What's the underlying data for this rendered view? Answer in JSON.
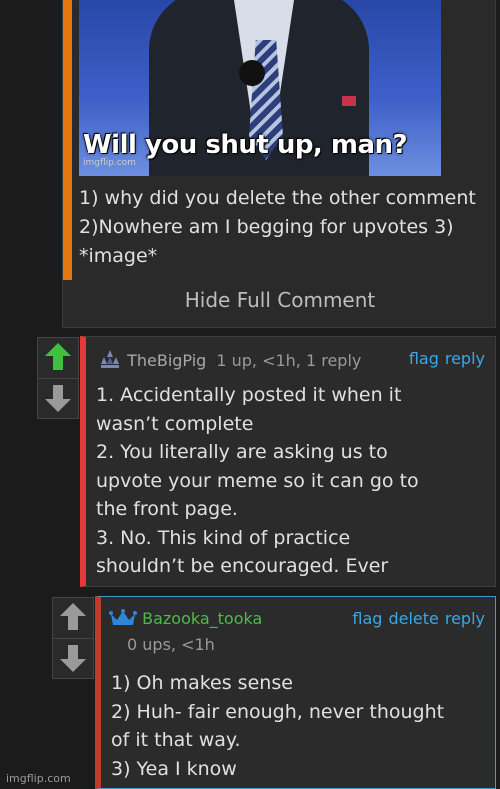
{
  "comment1": {
    "meme_caption": "Will you shut up, man?",
    "meme_watermark": "imgflip.com",
    "body": "1) why did you delete the other comment 2)Nowhere am I begging for upvotes 3) *image*",
    "hide_label": "Hide Full Comment",
    "accent_color": "#e4780e"
  },
  "comment2": {
    "username": "TheBigPig",
    "meta": "1 up, <1h, 1 reply",
    "actions": {
      "flag": "flag",
      "reply": "reply"
    },
    "lines": [
      "1. Accidentally posted it when it",
      "wasn’t complete",
      "2. You literally are asking us to",
      "upvote your meme so it can go to",
      "the front page.",
      "3. No. This kind of practice",
      "shouldn’t be encouraged. Ever"
    ],
    "upvoted": true,
    "accent_color": "#e23a3a"
  },
  "comment3": {
    "username": "Bazooka_tooka",
    "meta": "0 ups, <1h",
    "actions": {
      "flag": "flag",
      "delete": "delete",
      "reply": "reply"
    },
    "lines": [
      "1) Oh makes sense",
      "2) Huh- fair enough, never thought",
      "of it that way.",
      "3) Yea I know"
    ],
    "accent_color": "#4cbb4c"
  },
  "footer": {
    "watermark": "imgflip.com"
  },
  "icons": [
    "up-arrow-icon",
    "down-arrow-icon",
    "user-rank-icon",
    "crown-icon"
  ]
}
